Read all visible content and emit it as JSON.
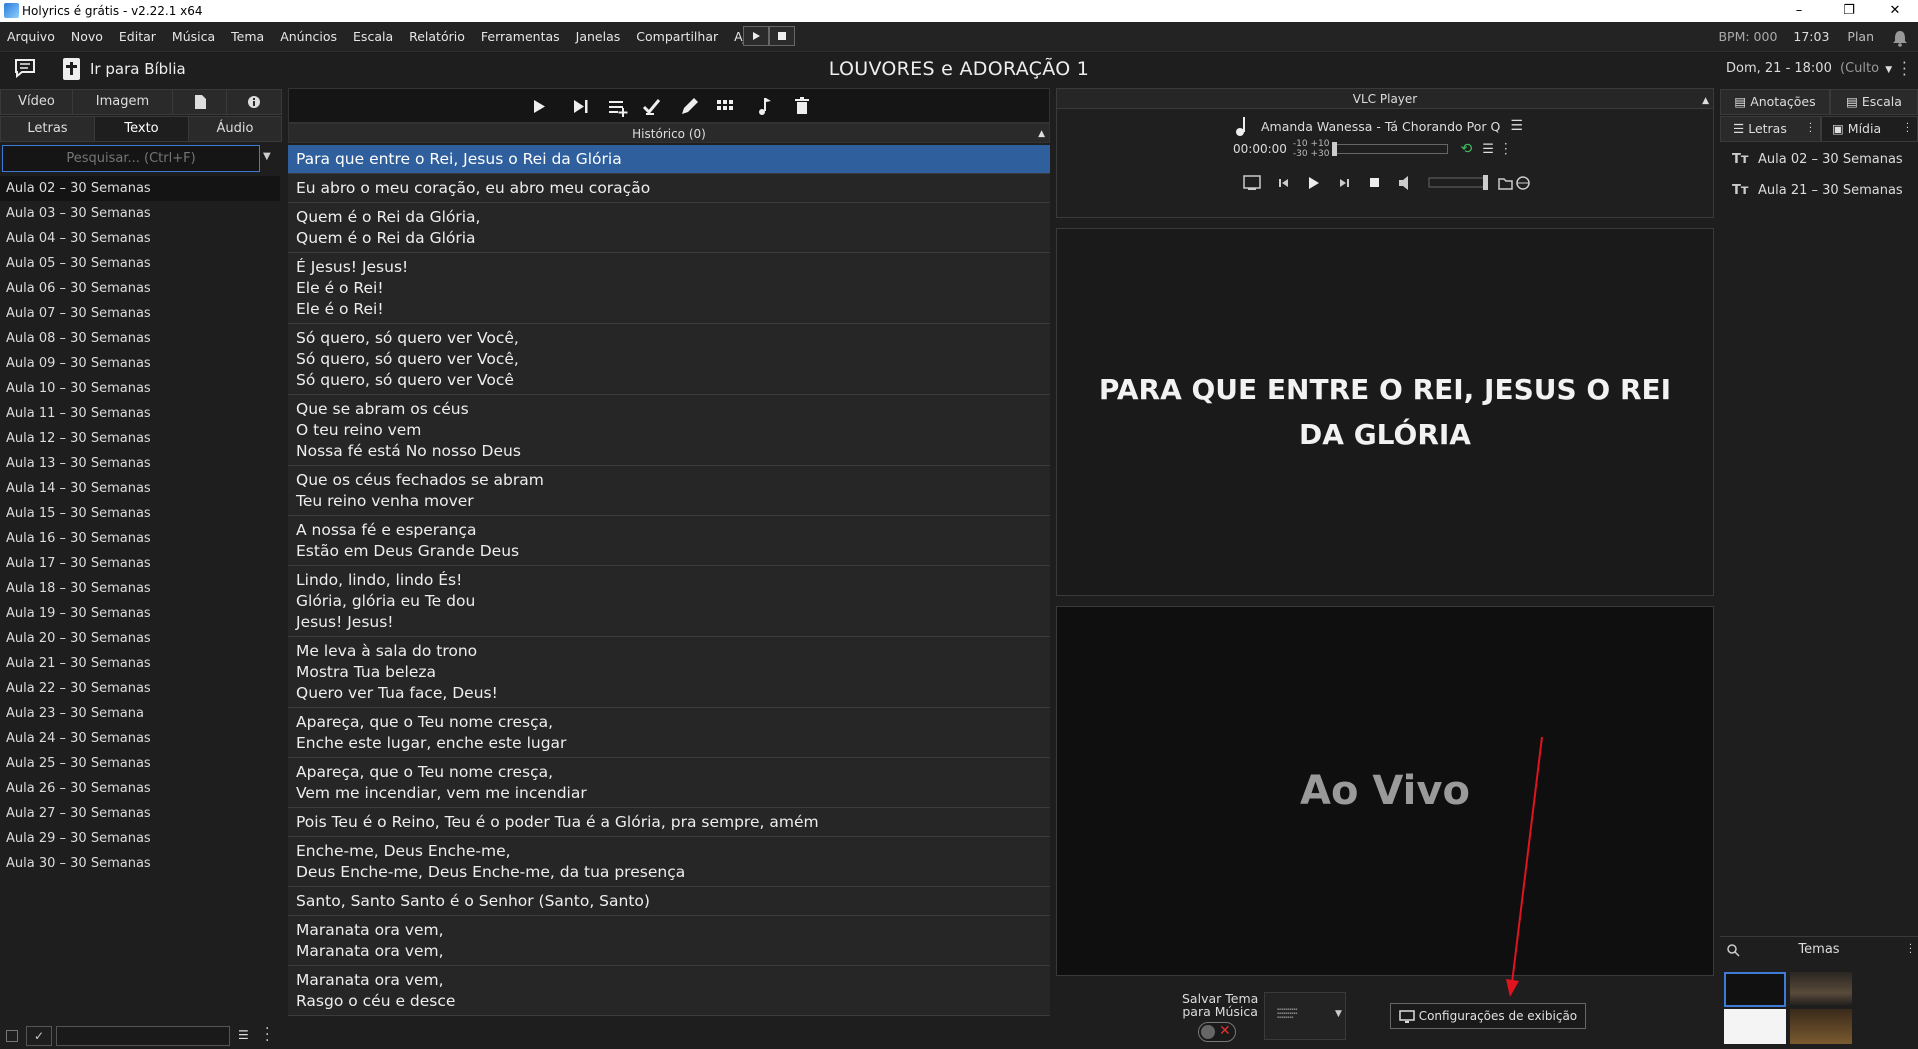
{
  "window": {
    "title": "Holyrics é grátis - v2.22.1 x64",
    "controls": [
      "–",
      "❐",
      "✕"
    ]
  },
  "menu": {
    "items": [
      "Arquivo",
      "Novo",
      "Editar",
      "Música",
      "Tema",
      "Anúncios",
      "Escala",
      "Relatório",
      "Ferramentas",
      "Janelas",
      "Compartilhar",
      "Ajuda"
    ],
    "bpm": "BPM: 000",
    "time": "17:03",
    "plan": "Plan"
  },
  "header": {
    "bible_button": "Ir para Bíblia",
    "title": "LOUVORES e ADORAÇÃO 1",
    "date": "Dom, 21 - 18:00",
    "event": "(Culto"
  },
  "left": {
    "tabs_top": [
      "Vídeo",
      "Imagem"
    ],
    "tabs_bottom": [
      "Letras",
      "Texto",
      "Áudio"
    ],
    "search_placeholder": "Pesquisar... (Ctrl+F)",
    "items": [
      "Aula 02 – 30 Semanas",
      "Aula 03 – 30 Semanas",
      "Aula 04 – 30 Semanas",
      "Aula 05 – 30 Semanas",
      "Aula 06 – 30 Semanas",
      "Aula 07 – 30 Semanas",
      "Aula 08 – 30 Semanas",
      "Aula 09 – 30 Semanas",
      "Aula 10 – 30 Semanas",
      "Aula 11 – 30 Semanas",
      "Aula 12 – 30 Semanas",
      "Aula 13 – 30 Semanas",
      "Aula 14 – 30 Semanas",
      "Aula 15 – 30 Semanas",
      "Aula 16 – 30 Semanas",
      "Aula 17 – 30 Semanas",
      "Aula 18 – 30 Semanas",
      "Aula 19 – 30 Semanas",
      "Aula 20 – 30 Semanas",
      "Aula 21 – 30 Semanas",
      "Aula 22 – 30 Semanas",
      "Aula 23 – 30 Semana",
      "Aula 24 – 30 Semanas",
      "Aula 25 – 30 Semanas",
      "Aula 26 – 30 Semanas",
      "Aula 27 – 30 Semanas",
      "Aula 29 – 30 Semanas",
      "Aula 30 – 30 Semanas"
    ]
  },
  "center": {
    "history": "Histórico (0)",
    "slides": [
      "Para que entre o Rei, Jesus o Rei da Glória",
      "Eu abro o meu coração, eu abro meu coração",
      "Quem é o Rei da Glória,\nQuem é o Rei da Glória",
      "É Jesus! Jesus!\nEle é o Rei!\nEle é o Rei!",
      "Só quero, só quero ver Você,\nSó quero, só quero ver Você,\nSó quero, só quero ver Você",
      "Que se abram os céus\nO teu reino vem\nNossa fé está No nosso Deus",
      "Que os céus fechados se abram\nTeu reino venha mover",
      "A nossa fé e esperança\nEstão em Deus Grande Deus",
      "Lindo, lindo, lindo És!\nGlória, glória eu Te dou\nJesus! Jesus!",
      "Me leva à sala do trono\nMostra Tua beleza\nQuero ver Tua face, Deus!",
      "Apareça, que o Teu nome cresça,\nEnche este lugar, enche este lugar",
      "Apareça, que o Teu nome cresça,\nVem me incendiar, vem me incendiar",
      "Pois Teu é o Reino, Teu é o poder Tua é a Glória, pra sempre, amém",
      "Enche-me, Deus Enche-me,\nDeus Enche-me, Deus Enche-me, da tua presença",
      "Santo, Santo Santo é o Senhor (Santo, Santo)",
      "Maranata ora vem,\nMaranata ora vem,",
      "Maranata ora vem,\nRasgo o céu e desce"
    ]
  },
  "vlc": {
    "title": "VLC Player",
    "track": "Amanda Wanessa - Tá Chorando Por Q",
    "time": "00:00:00",
    "skip_top": "-10 +10",
    "skip_bottom": "-30 +30"
  },
  "preview": {
    "text": "PARA QUE ENTRE O REI, JESUS O REI DA GLÓRIA"
  },
  "live": {
    "text": "Ao Vivo"
  },
  "bottom": {
    "save_theme_line1": "Salvar Tema",
    "save_theme_line2": "para Música",
    "display_settings": "Configurações de exibição"
  },
  "farright": {
    "tab_notes": "Anotações",
    "tab_scale": "Escala",
    "tab_lyrics": "Letras",
    "tab_media": "Mídia",
    "items": [
      "Aula 02 – 30 Semanas",
      "Aula 21 – 30 Semanas"
    ],
    "themes_label": "Temas"
  },
  "colors": {
    "selection": "#2f5f9c",
    "annotation_arrow": "#e0141e"
  }
}
